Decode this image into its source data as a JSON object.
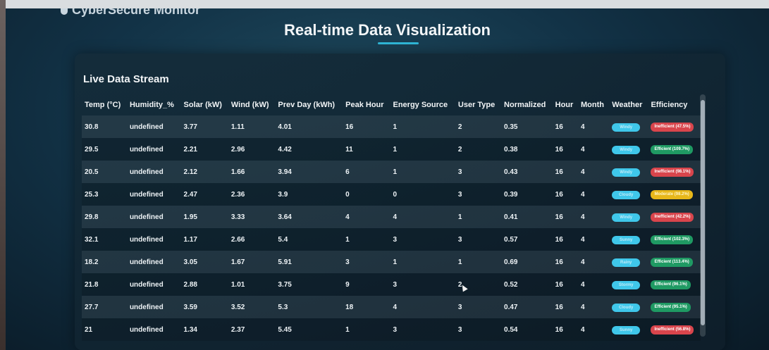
{
  "app": {
    "brand": "CyberSecure Monitor"
  },
  "page": {
    "title": "Real-time Data Visualization"
  },
  "panel": {
    "title": "Live Data Stream"
  },
  "table": {
    "headers": [
      "Temp (°C)",
      "Humidity_%",
      "Solar (kW)",
      "Wind (kW)",
      "Prev Day (kWh)",
      "Peak Hour",
      "Energy Source",
      "User Type",
      "Normalized",
      "Hour",
      "Month",
      "Weather",
      "Efficiency"
    ],
    "rows": [
      {
        "temp": "30.8",
        "humidity": "undefined",
        "solar": "3.77",
        "wind": "1.11",
        "prev": "4.01",
        "peak": "16",
        "source": "1",
        "user": "2",
        "norm": "0.35",
        "hour": "16",
        "month": "4",
        "weather": "Windy",
        "eff": "Inefficient (47.5%)",
        "eff_status": "red"
      },
      {
        "temp": "29.5",
        "humidity": "undefined",
        "solar": "2.21",
        "wind": "2.96",
        "prev": "4.42",
        "peak": "11",
        "source": "1",
        "user": "2",
        "norm": "0.38",
        "hour": "16",
        "month": "4",
        "weather": "Windy",
        "eff": "Efficient (109.7%)",
        "eff_status": "green"
      },
      {
        "temp": "20.5",
        "humidity": "undefined",
        "solar": "2.12",
        "wind": "1.66",
        "prev": "3.94",
        "peak": "6",
        "source": "1",
        "user": "3",
        "norm": "0.43",
        "hour": "16",
        "month": "4",
        "weather": "Windy",
        "eff": "Inefficient (98.1%)",
        "eff_status": "red"
      },
      {
        "temp": "25.3",
        "humidity": "undefined",
        "solar": "2.47",
        "wind": "2.36",
        "prev": "3.9",
        "peak": "0",
        "source": "0",
        "user": "3",
        "norm": "0.39",
        "hour": "16",
        "month": "4",
        "weather": "Cloudy",
        "eff": "Moderate (98.2%)",
        "eff_status": "yellow"
      },
      {
        "temp": "29.8",
        "humidity": "undefined",
        "solar": "1.95",
        "wind": "3.33",
        "prev": "3.64",
        "peak": "4",
        "source": "4",
        "user": "1",
        "norm": "0.41",
        "hour": "16",
        "month": "4",
        "weather": "Windy",
        "eff": "Inefficient (42.2%)",
        "eff_status": "red"
      },
      {
        "temp": "32.1",
        "humidity": "undefined",
        "solar": "1.17",
        "wind": "2.66",
        "prev": "5.4",
        "peak": "1",
        "source": "3",
        "user": "3",
        "norm": "0.57",
        "hour": "16",
        "month": "4",
        "weather": "Sunny",
        "eff": "Efficient (102.3%)",
        "eff_status": "green"
      },
      {
        "temp": "18.2",
        "humidity": "undefined",
        "solar": "3.05",
        "wind": "1.67",
        "prev": "5.91",
        "peak": "3",
        "source": "1",
        "user": "1",
        "norm": "0.69",
        "hour": "16",
        "month": "4",
        "weather": "Rainy",
        "eff": "Efficient (113.4%)",
        "eff_status": "green"
      },
      {
        "temp": "21.8",
        "humidity": "undefined",
        "solar": "2.88",
        "wind": "1.01",
        "prev": "3.75",
        "peak": "9",
        "source": "3",
        "user": "2",
        "norm": "0.52",
        "hour": "16",
        "month": "4",
        "weather": "Stormy",
        "eff": "Efficient (96.1%)",
        "eff_status": "green"
      },
      {
        "temp": "27.7",
        "humidity": "undefined",
        "solar": "3.59",
        "wind": "3.52",
        "prev": "5.3",
        "peak": "18",
        "source": "4",
        "user": "3",
        "norm": "0.47",
        "hour": "16",
        "month": "4",
        "weather": "Cloudy",
        "eff": "Efficient (95.1%)",
        "eff_status": "green"
      },
      {
        "temp": "21",
        "humidity": "undefined",
        "solar": "1.34",
        "wind": "2.37",
        "prev": "5.45",
        "peak": "1",
        "source": "3",
        "user": "3",
        "norm": "0.54",
        "hour": "16",
        "month": "4",
        "weather": "Sunny",
        "eff": "Inefficient (56.8%)",
        "eff_status": "red"
      }
    ]
  }
}
